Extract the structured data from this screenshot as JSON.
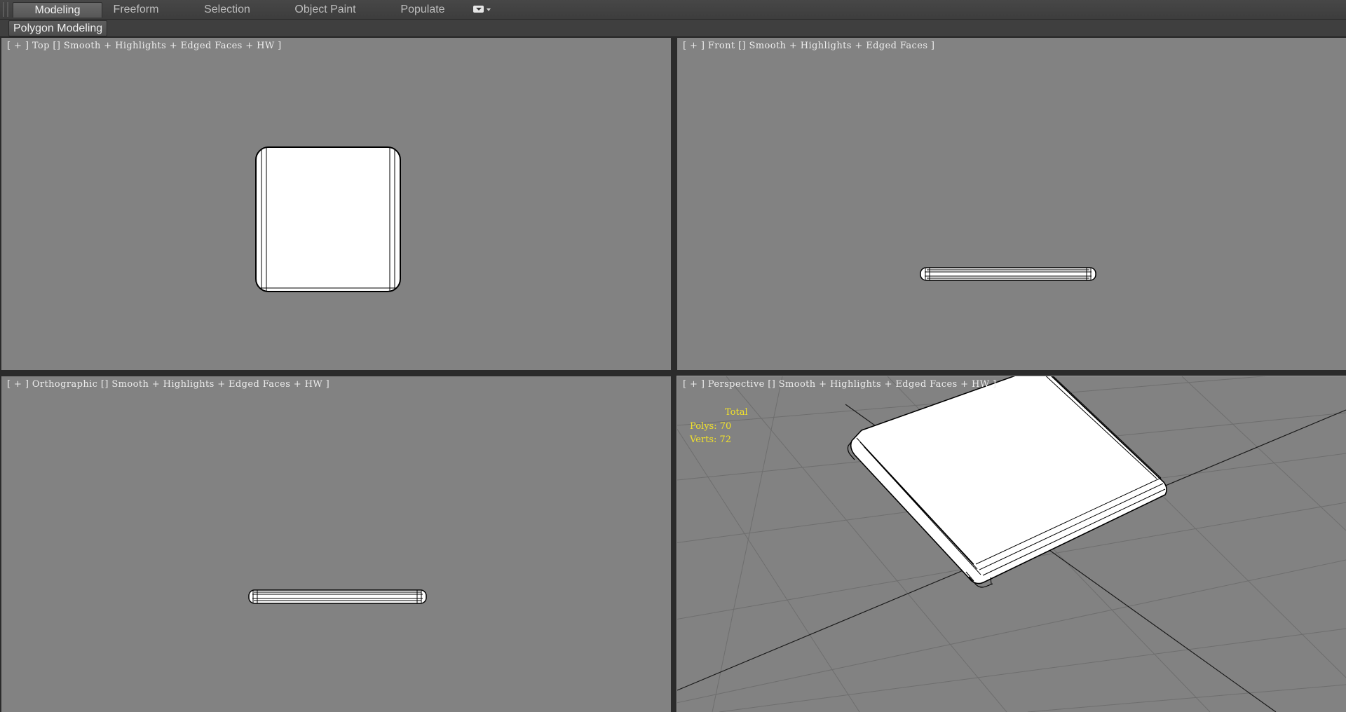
{
  "ribbon": {
    "tabs": [
      {
        "label": "Modeling",
        "active": true
      },
      {
        "label": "Freeform",
        "active": false
      },
      {
        "label": "Selection",
        "active": false
      },
      {
        "label": "Object Paint",
        "active": false
      },
      {
        "label": "Populate",
        "active": false
      }
    ],
    "tab_menu_icon": "ribbon-display-options-icon",
    "panel_button": "Polygon Modeling"
  },
  "viewports": {
    "top": {
      "label": "[ + ] Top [] Smooth + Highlights + Edged Faces + HW ]"
    },
    "front": {
      "label": "[ + ] Front [] Smooth + Highlights + Edged Faces ]"
    },
    "orthographic": {
      "label": "[ + ] Orthographic [] Smooth + Highlights + Edged Faces + HW ]"
    },
    "perspective": {
      "label": "[ + ] Perspective [] Smooth + Highlights + Edged Faces + HW ]",
      "active": true,
      "stats": {
        "total": "Total",
        "polys": "Polys: 70",
        "verts": "Verts: 72"
      }
    }
  },
  "colors": {
    "viewport_bg": "#828282",
    "object_face": "#ffffff",
    "edge": "#000000",
    "stats_text": "#f2e22a",
    "ui_dark": "#3f3f3f"
  }
}
